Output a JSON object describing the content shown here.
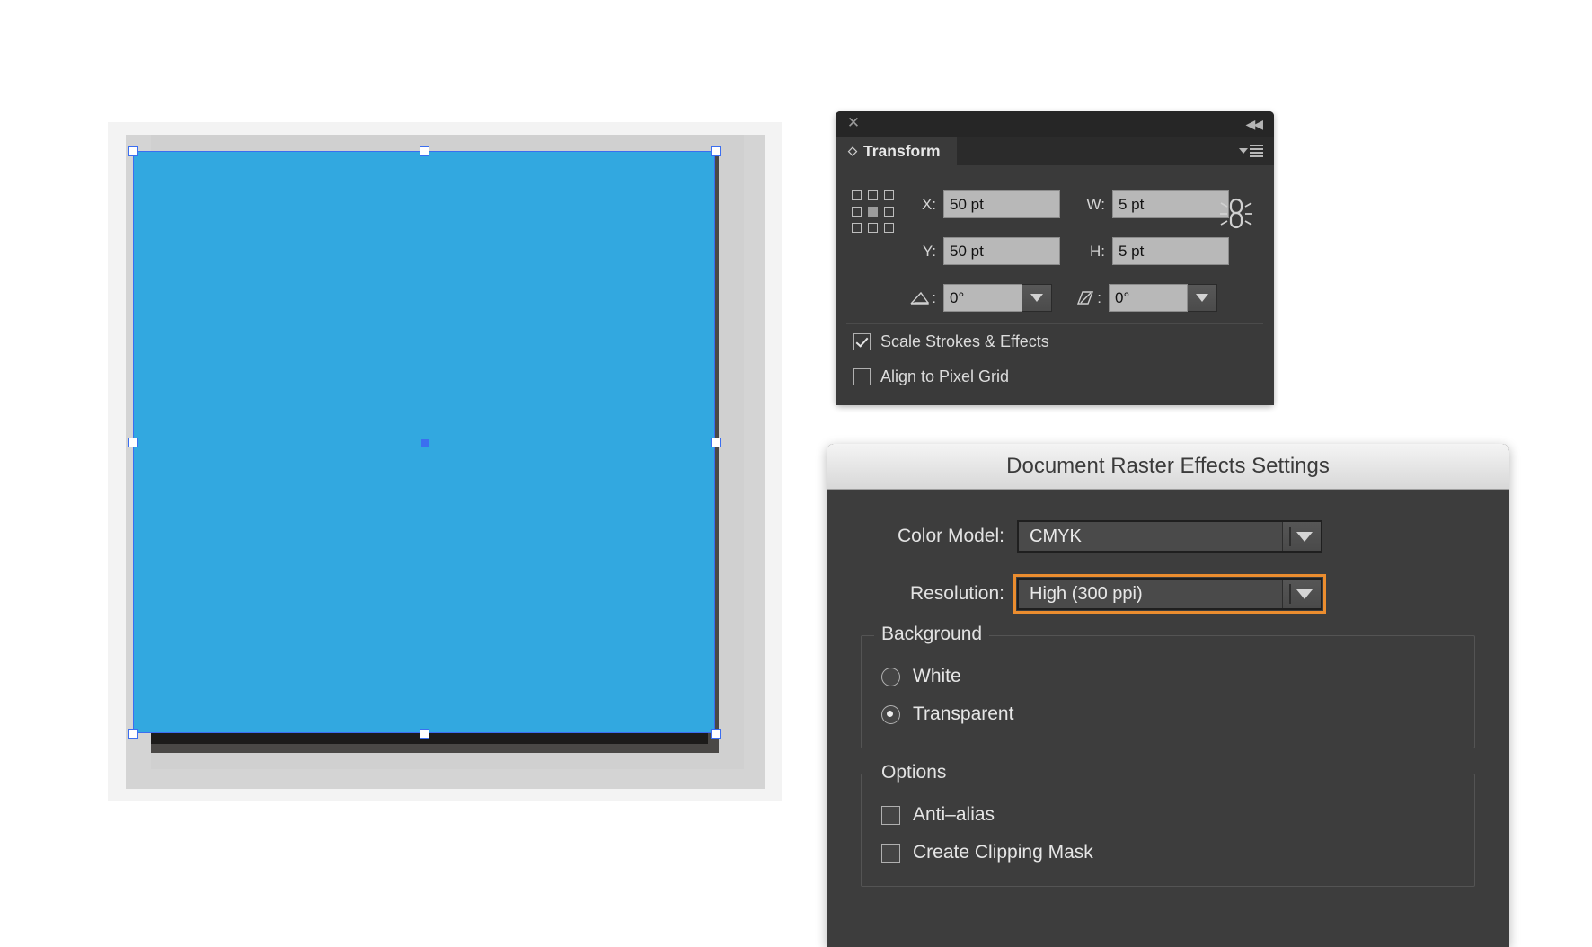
{
  "canvas": {
    "artwork_fill": "#32a8e0",
    "selection_color": "#3b6ef0",
    "handle_count": 8
  },
  "transform_panel": {
    "close_icon": "close-icon",
    "collapse_icon": "◀◀",
    "tab_label": "Transform",
    "tab_diamond": "◇",
    "reference_point": "center",
    "fields": {
      "x_label": "X:",
      "x_value": "50 pt",
      "w_label": "W:",
      "w_value": "5 pt",
      "y_label": "Y:",
      "y_value": "50 pt",
      "h_label": "H:",
      "h_value": "5 pt",
      "rotate_label": "rotate-icon",
      "rotate_value": "0°",
      "shear_label": "shear-icon",
      "shear_value": "0°"
    },
    "checkboxes": [
      {
        "label": "Scale Strokes & Effects",
        "checked": true
      },
      {
        "label": "Align to Pixel Grid",
        "checked": false
      }
    ]
  },
  "dialog": {
    "title": "Document Raster Effects Settings",
    "color_model": {
      "label": "Color Model:",
      "value": "CMYK",
      "focused": false
    },
    "resolution": {
      "label": "Resolution:",
      "value": "High (300 ppi)",
      "focused": true,
      "focus_color": "#eb8d2f"
    },
    "background": {
      "legend": "Background",
      "options": [
        {
          "label": "White",
          "selected": false
        },
        {
          "label": "Transparent",
          "selected": true
        }
      ]
    },
    "options": {
      "legend": "Options",
      "items": [
        {
          "label": "Anti–alias",
          "checked": false
        },
        {
          "label": "Create Clipping Mask",
          "checked": false
        }
      ]
    }
  }
}
